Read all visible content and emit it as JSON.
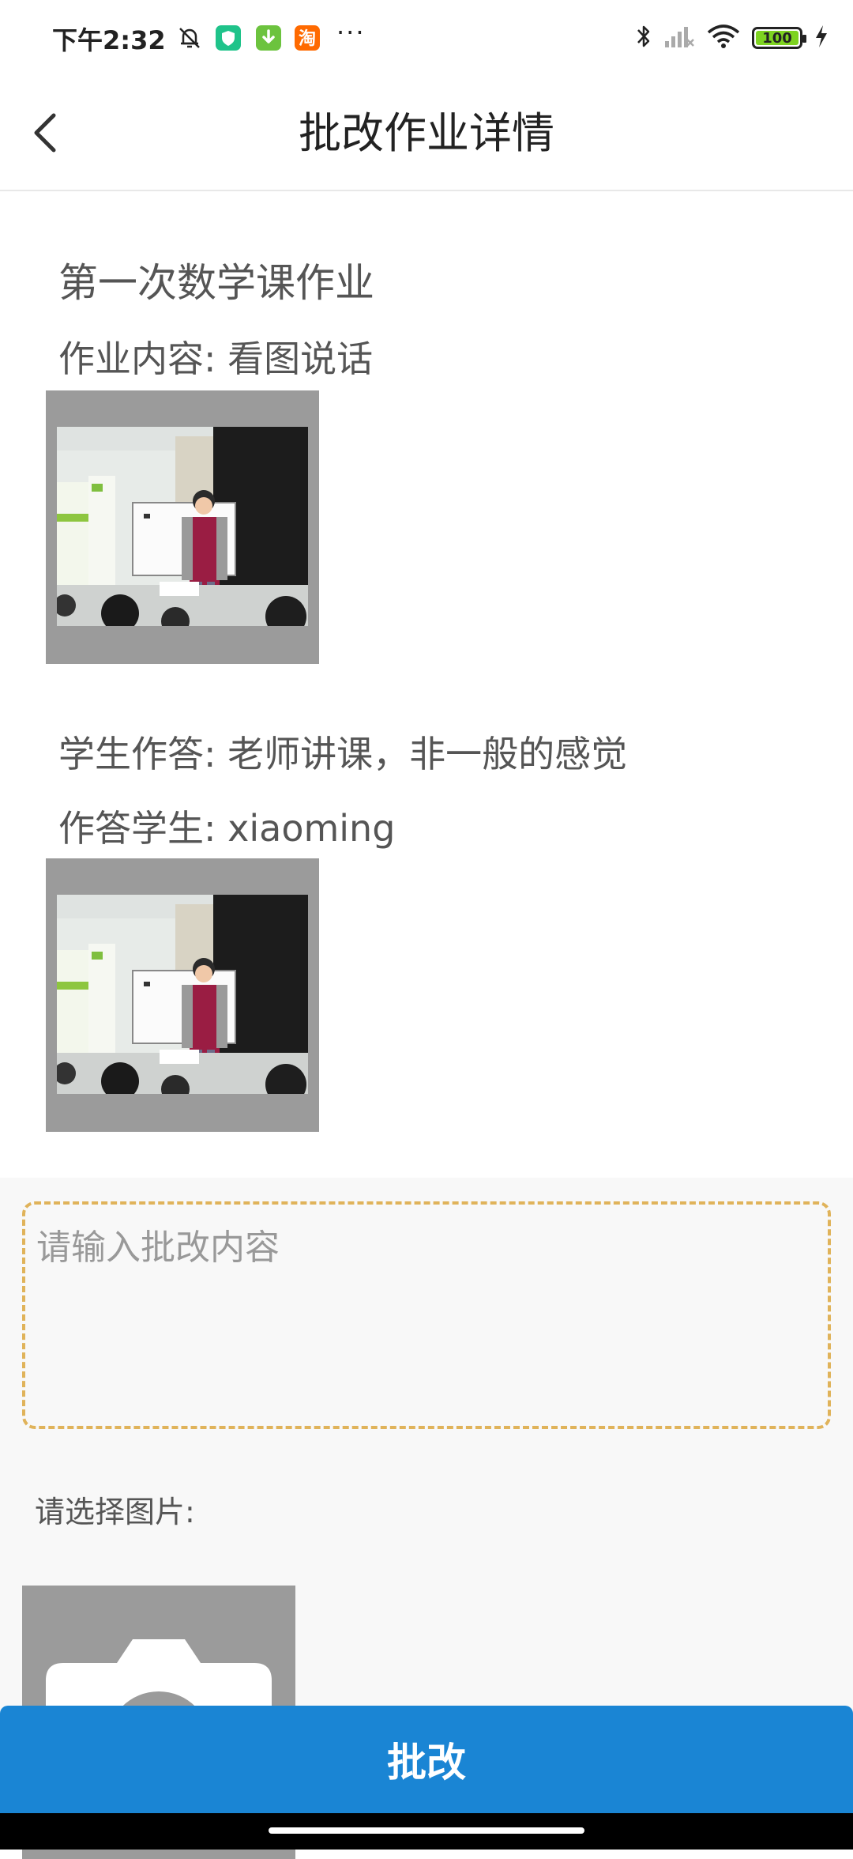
{
  "status_bar": {
    "time": "下午2:32",
    "more_dots": "···",
    "battery_level": "100",
    "icons": [
      "bell-off-icon",
      "shield-app-icon",
      "download-app-icon",
      "taobao-app-icon",
      "bluetooth-icon",
      "signal-icon",
      "wifi-icon",
      "battery-icon",
      "charging-icon"
    ],
    "taobao_glyph": "淘"
  },
  "header": {
    "title": "批改作业详情",
    "back_icon": "chevron-left-icon"
  },
  "homework": {
    "title": "第一次数学课作业",
    "content_label": "作业内容:",
    "content_value": "看图说话",
    "answer_label": "学生作答:",
    "answer_value": "老师讲课，非一般的感觉",
    "student_label": "作答学生:",
    "student_value": "xiaoming"
  },
  "grading": {
    "input_placeholder": "请输入批改内容",
    "input_value": "",
    "select_image_label": "请选择图片:",
    "camera_icon": "camera-icon"
  },
  "submit": {
    "label": "批改"
  },
  "colors": {
    "accent": "#1a85d4",
    "dashed_border": "#e0b35a",
    "photo_frame": "#9b9b9b"
  }
}
